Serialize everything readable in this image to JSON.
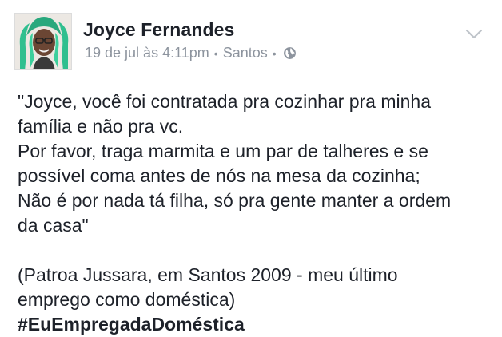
{
  "post": {
    "author": "Joyce Fernandes",
    "timestamp": "19 de jul às 4:11pm",
    "location": "Santos",
    "separator": "•",
    "privacy_icon": "globe-icon",
    "menu_icon": "chevron-down-icon",
    "lines": [
      "\"Joyce, você foi contratada pra cozinhar pra minha",
      "família e não pra vc.",
      "Por favor, traga marmita e um par de talheres e se",
      "possível coma antes de nós na mesa da cozinha;",
      "Não é por nada tá filha, só pra gente manter a ordem",
      "da casa\""
    ],
    "quote_source_lines": [
      "(Patroa Jussara, em Santos 2009 - meu último",
      "emprego como doméstica)"
    ],
    "hashtag": "#EuEmpregadaDoméstica"
  },
  "colors": {
    "text": "#1d2129",
    "meta": "#8d949e",
    "avatar_hair": "#2fbf8f"
  }
}
